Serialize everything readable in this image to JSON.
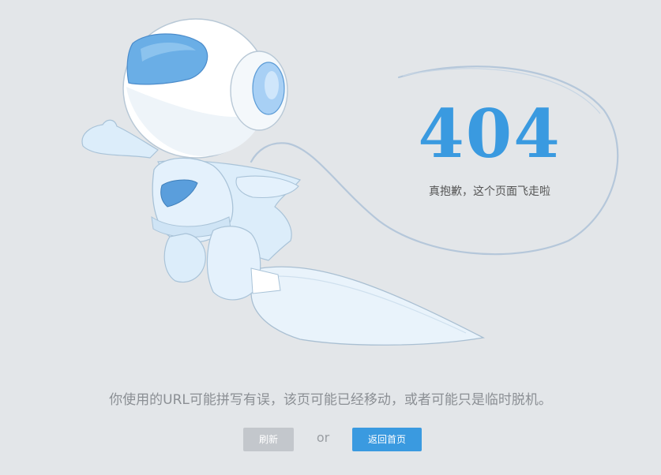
{
  "error": {
    "code": "404",
    "subtitle": "真抱歉，这个页面飞走啦"
  },
  "message": "你使用的URL可能拼写有误，该页可能已经移动，或者可能只是临时脱机。",
  "actions": {
    "refresh_label": "刷新",
    "or_label": "or",
    "home_label": "返回首页"
  },
  "colors": {
    "background": "#e3e6e9",
    "accent": "#3a9ae0",
    "secondary_button": "#c3c7cc"
  },
  "icons": {
    "illustration": "astronaut-robot-illustration"
  }
}
